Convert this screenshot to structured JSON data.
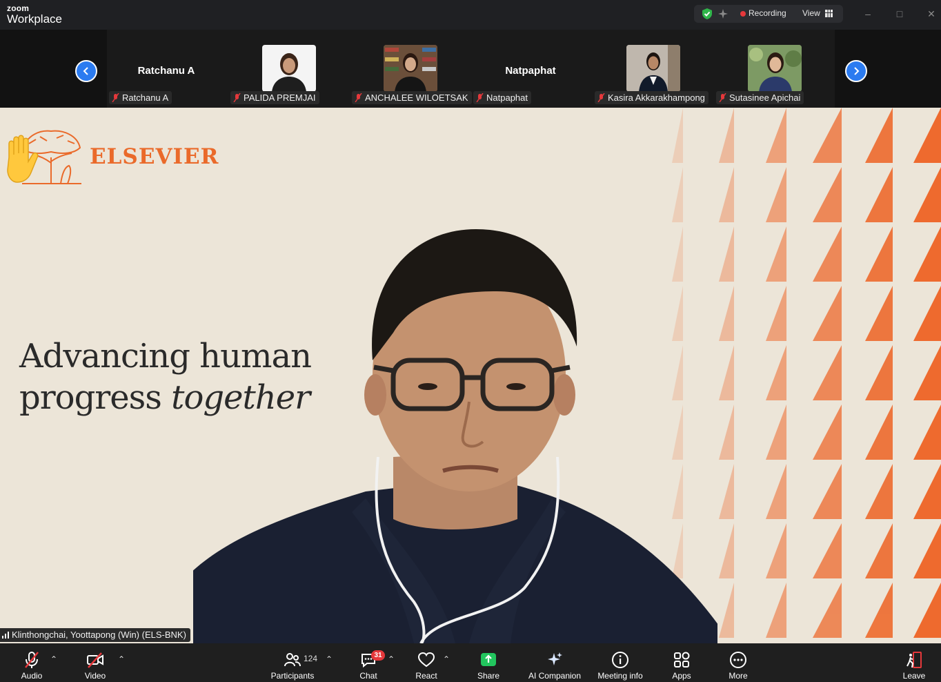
{
  "app": {
    "brand_small": "zoom",
    "brand_large": "Workplace"
  },
  "status": {
    "recording_label": "Recording",
    "view_label": "View"
  },
  "participants": [
    {
      "name": "Ratchanu A",
      "display": "Ratchanu A",
      "has_video": false
    },
    {
      "name": "PALIDA PREMJAI",
      "display": "",
      "has_video": true
    },
    {
      "name": "ANCHALEE WILOETSAK",
      "display": "",
      "has_video": true
    },
    {
      "name": "Natpaphat",
      "display": "Natpaphat",
      "has_video": false
    },
    {
      "name": "Kasira Akkarakhampong",
      "display": "",
      "has_video": true
    },
    {
      "name": "Sutasinee Apichai",
      "display": "",
      "has_video": true
    }
  ],
  "main_video": {
    "logo_text": "ELSEVIER",
    "slogan_line1": "Advancing human",
    "slogan_line2_a": "progress ",
    "slogan_line2_b": "together",
    "speaker_name": "Klinthongchai, Yoottapong (Win) (ELS-BNK)"
  },
  "toolbar": {
    "audio": "Audio",
    "video": "Video",
    "participants": "Participants",
    "participants_count": "124",
    "chat": "Chat",
    "chat_badge": "31",
    "react": "React",
    "share": "Share",
    "ai_companion": "AI Companion",
    "meeting_info": "Meeting info",
    "apps": "Apps",
    "more": "More",
    "leave": "Leave"
  },
  "colors": {
    "accent_blue": "#2b7bf0",
    "share_green": "#22c55e",
    "elsevier_orange": "#ea6a2a",
    "recording_red": "#e5383b"
  }
}
